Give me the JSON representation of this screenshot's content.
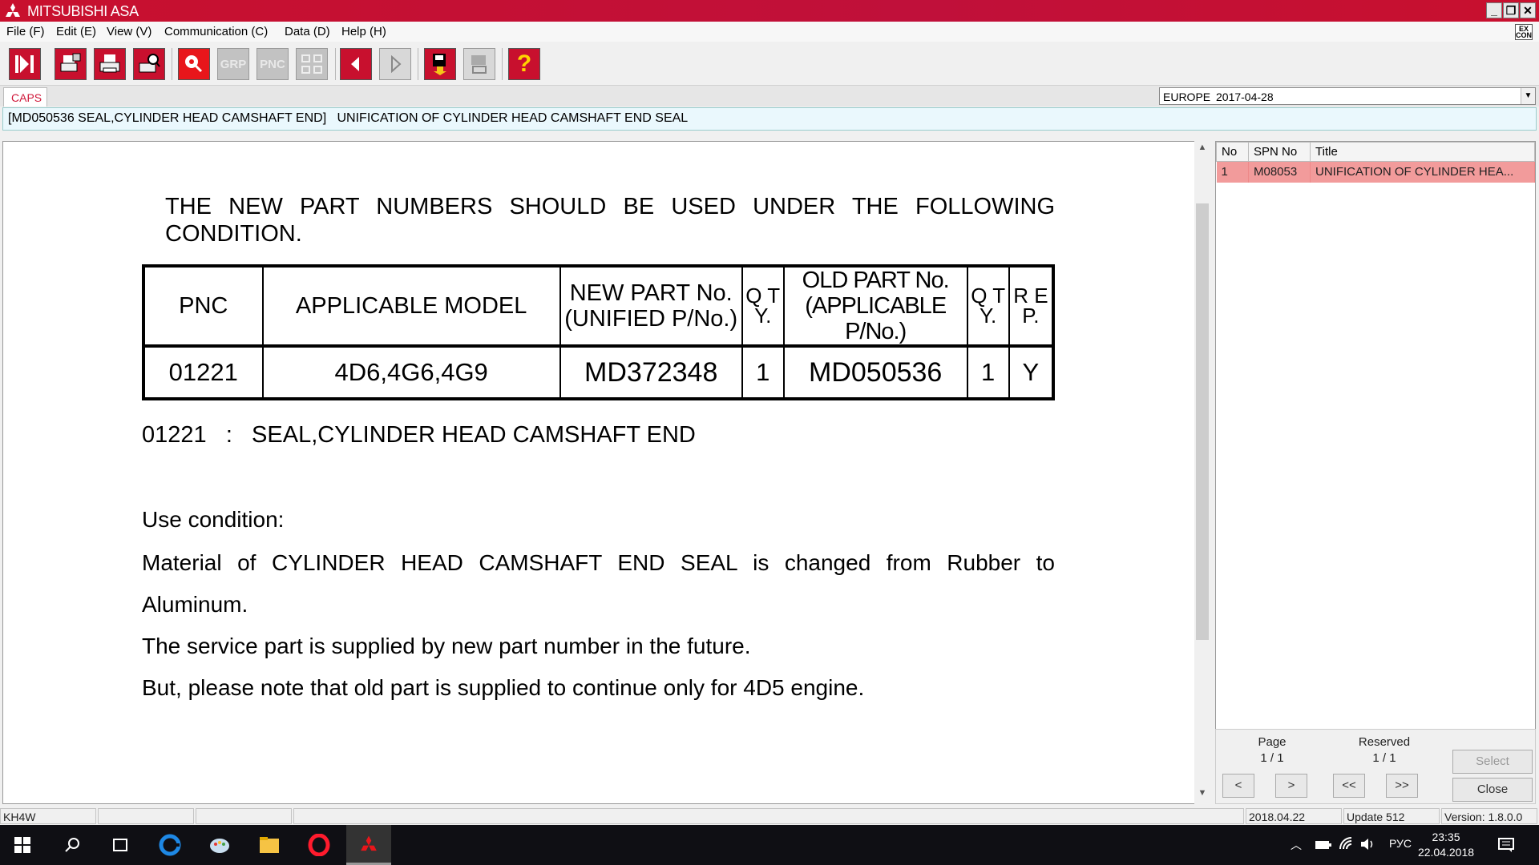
{
  "window": {
    "title": "MITSUBISHI ASA",
    "buttons": {
      "minimize": "_",
      "restore": "❐",
      "close": "✕"
    }
  },
  "menu": {
    "items": [
      "File (F)",
      "Edit (E)",
      "View (V)",
      "Communication (C)",
      "Data (D)",
      "Help (H)"
    ],
    "ex_icon": "EX CON"
  },
  "toolbar": {
    "grp_label": "GRP",
    "pnc_label": "PNC",
    "help_label": "?"
  },
  "tabs": {
    "caps": "CAPS"
  },
  "region": {
    "name": "EUROPE",
    "date": "2017-04-28"
  },
  "info_line": "[MD050536 SEAL,CYLINDER HEAD CAMSHAFT END]   UNIFICATION OF CYLINDER HEAD CAMSHAFT END SEAL",
  "document": {
    "heading": "THE NEW PART NUMBERS SHOULD BE USED UNDER THE FOLLOWING CONDITION.",
    "table": {
      "headers": {
        "pnc": "PNC",
        "model": "APPLICABLE MODEL",
        "new_part_1": "NEW PART No.",
        "new_part_2": "(UNIFIED P/No.)",
        "qty1": "Q T Y.",
        "old_part_1": "OLD PART No.",
        "old_part_2": "(APPLICABLE P/No.)",
        "qty2": "Q T Y.",
        "rep": "R E P."
      },
      "row": {
        "pnc": "01221",
        "model": "4D6,4G6,4G9",
        "new_part": "MD372348",
        "qty1": "1",
        "old_part": "MD050536",
        "qty2": "1",
        "rep": "Y"
      }
    },
    "caption": "01221   :   SEAL,CYLINDER HEAD CAMSHAFT END",
    "use_condition": "Use condition:",
    "para1": "Material of CYLINDER HEAD CAMSHAFT END SEAL is changed from Rubber to Aluminum.",
    "para2": "The service part is supplied by new part number in the future.",
    "para3": "But, please note that old part is supplied to continue only for 4D5 engine."
  },
  "spn_list": {
    "headers": {
      "no": "No",
      "spn": "SPN No",
      "title": "Title"
    },
    "rows": [
      {
        "no": "1",
        "spn": "M08053",
        "title": "UNIFICATION OF CYLINDER HEA..."
      }
    ],
    "page_label": "Page",
    "page_value": "1 / 1",
    "reserved_label": "Reserved",
    "reserved_value": "1 / 1",
    "buttons": {
      "prev": "<",
      "next": ">",
      "first": "<<",
      "last": ">>",
      "select": "Select",
      "close": "Close"
    }
  },
  "status": {
    "model": "KH4W",
    "date": "2018.04.22",
    "update": "Update 512",
    "version": "Version: 1.8.0.0"
  },
  "taskbar": {
    "lang": "РУС",
    "time": "23:35",
    "date": "22.04.2018"
  }
}
